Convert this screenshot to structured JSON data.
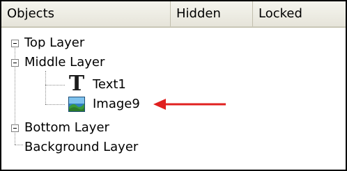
{
  "columns": {
    "objects": "Objects",
    "hidden": "Hidden",
    "locked": "Locked"
  },
  "tree": {
    "top_layer": "Top Layer",
    "middle_layer": "Middle Layer",
    "text1": "Text1",
    "image9": "Image9",
    "bottom_layer": "Bottom Layer",
    "background_layer": "Background Layer"
  },
  "icons": {
    "text_object": "text-T-icon",
    "image_object": "picture-icon",
    "collapse_toggle": "minus-box-icon",
    "callout": "red-arrow"
  },
  "colors": {
    "arrow": "#e0201f",
    "header_bg": "#ebe9df",
    "tree_lines": "#8a8a8a"
  }
}
